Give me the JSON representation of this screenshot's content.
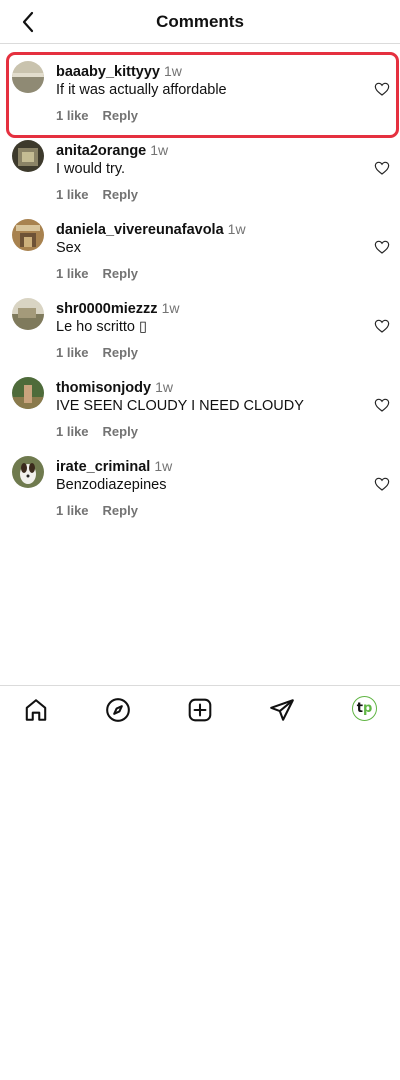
{
  "header": {
    "title": "Comments",
    "back_icon": "chevron-left-icon"
  },
  "comments": [
    {
      "username": "baaaby_kittyyy",
      "time": "1w",
      "text": "If it was actually affordable",
      "likes": "1 like",
      "reply": "Reply",
      "highlighted": true
    },
    {
      "username": "anita2orange",
      "time": "1w",
      "text": "I would try.",
      "likes": "1 like",
      "reply": "Reply"
    },
    {
      "username": "daniela_vivereunafavola",
      "time": "1w",
      "text": "Sex",
      "likes": "1 like",
      "reply": "Reply"
    },
    {
      "username": "shr0000miezzz",
      "time": "1w",
      "text": "Le ho scritto ▯",
      "likes": "1 like",
      "reply": "Reply"
    },
    {
      "username": "thomisonjody",
      "time": "1w",
      "text": "IVE SEEN CLOUDY I NEED CLOUDY",
      "likes": "1 like",
      "reply": "Reply"
    },
    {
      "username": "irate_criminal",
      "time": "1w",
      "text": "Benzodiazepines",
      "likes": "1 like",
      "reply": "Reply"
    }
  ],
  "bottom_nav": {
    "items": [
      "home-icon",
      "explore-compass-icon",
      "create-post-icon",
      "direct-messages-icon"
    ],
    "profile_letters": {
      "t": "t",
      "p": "p"
    },
    "profile_color": "#60b544"
  },
  "colors": {
    "highlight": "#e5303f",
    "secondary_text": "#737373",
    "divider": "#dbdbdb"
  }
}
